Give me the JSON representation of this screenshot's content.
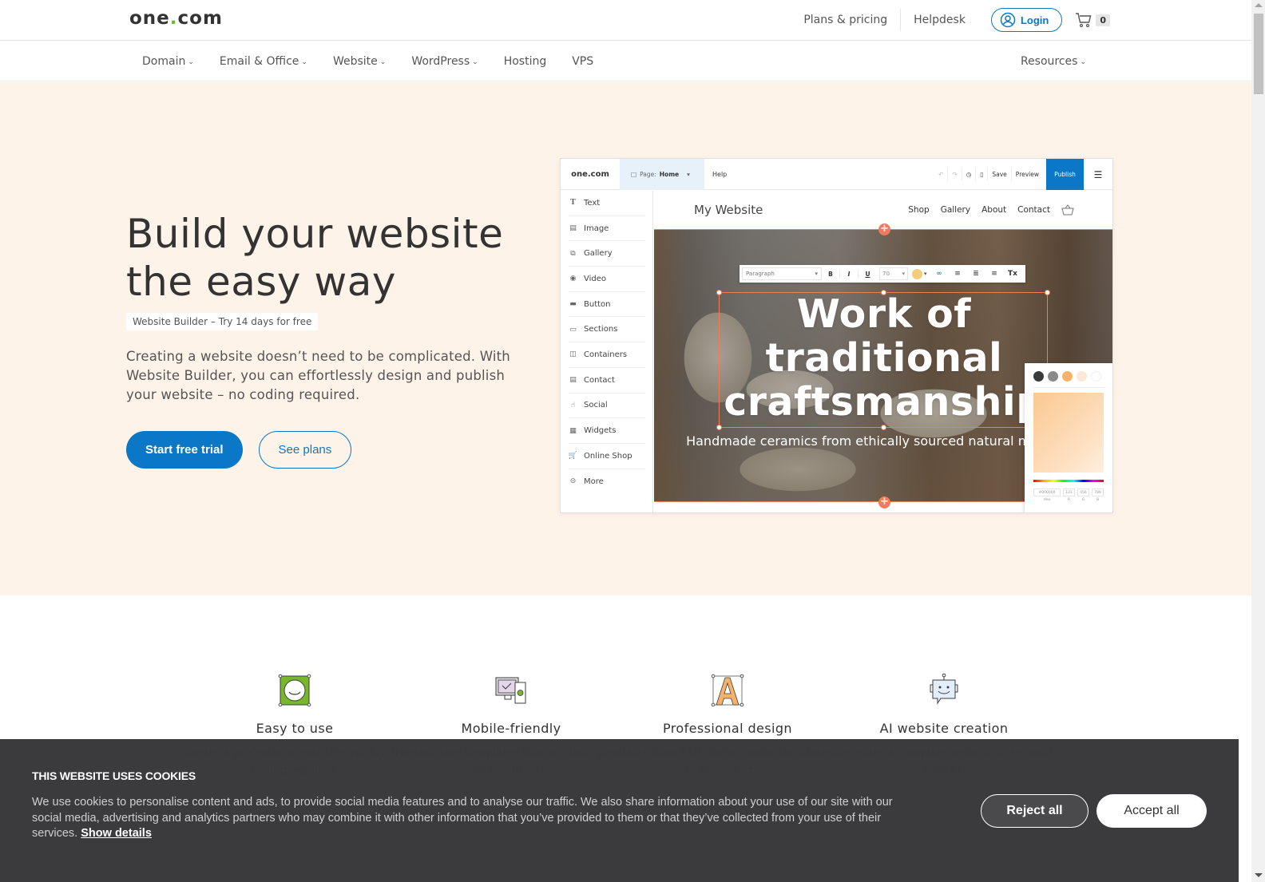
{
  "header": {
    "logo_text": "one",
    "logo_dot": ".",
    "logo_suffix": "com",
    "links": [
      "Plans & pricing",
      "Helpdesk"
    ],
    "login_label": "Login",
    "cart_count": "0"
  },
  "nav": {
    "items": [
      {
        "label": "Domain",
        "dropdown": true
      },
      {
        "label": "Email & Office",
        "dropdown": true
      },
      {
        "label": "Website",
        "dropdown": true
      },
      {
        "label": "WordPress",
        "dropdown": true
      },
      {
        "label": "Hosting",
        "dropdown": false
      },
      {
        "label": "VPS",
        "dropdown": false
      }
    ],
    "right_item": "Resources"
  },
  "hero": {
    "title_line1": "Build your website",
    "title_line2": "the easy way",
    "badge": "Website Builder – Try 14 days for free",
    "description": "Creating a website doesn’t need to be complicated. With Website Builder, you can effortlessly design and publish your website – no coding required.",
    "primary_cta": "Start free trial",
    "secondary_cta": "See plans",
    "background_color": "#fef3e8",
    "accent_color": "#0a78c6"
  },
  "builder_mock": {
    "logo": "one.com",
    "page_label": "Page:",
    "page_value": "Home",
    "help": "Help",
    "actions": [
      "Save",
      "Preview"
    ],
    "publish": "Publish",
    "sidebar": [
      "Text",
      "Image",
      "Gallery",
      "Video",
      "Button",
      "Sections",
      "Containers",
      "Contact",
      "Social",
      "Widgets",
      "Online Shop",
      "More"
    ],
    "site_title": "My Website",
    "site_nav": [
      "Shop",
      "Gallery",
      "About",
      "Contact"
    ],
    "format_toolbar": {
      "style": "Paragraph",
      "bold": "B",
      "italic": "I",
      "underline": "U",
      "font_size": "70",
      "clear_format": "Tx"
    },
    "hero_heading_lines": [
      "Work of",
      "traditional",
      "craftsmanship"
    ],
    "hero_sub": "Handmade ceramics from ethically sourced natural materials.",
    "color_picker": {
      "swatches": [
        "#3a3a3a",
        "#8a8a8a",
        "#f6b26b",
        "#fde8d6",
        "#ffffff"
      ],
      "hex_value": "#000000",
      "r": "123",
      "g": "456",
      "b": "789",
      "labels": [
        "Hex",
        "R",
        "G",
        "B"
      ]
    },
    "selection_color": "#f07c5d"
  },
  "features": [
    {
      "title": "Easy to use",
      "description": "Create a professional website quickly. No coding required."
    },
    {
      "title": "Mobile-friendly",
      "description": "Responsive templates that will look good on any device."
    },
    {
      "title": "Professional design",
      "description": "More than 140 customisable templates to choose from."
    },
    {
      "title": "AI website creation",
      "description": "Generate a complete website in seconds with AI."
    }
  ],
  "cookie_banner": {
    "title": "THIS WEBSITE USES COOKIES",
    "text": "We use cookies to personalise content and ads, to provide social media features and to analyse our traffic. We also share information about your use of our site with our social media, advertising and analytics partners who may combine it with other information that you’ve provided to them or that they’ve collected from your use of their services.",
    "details_link": "Show details",
    "reject_label": "Reject all",
    "accept_label": "Accept all"
  }
}
